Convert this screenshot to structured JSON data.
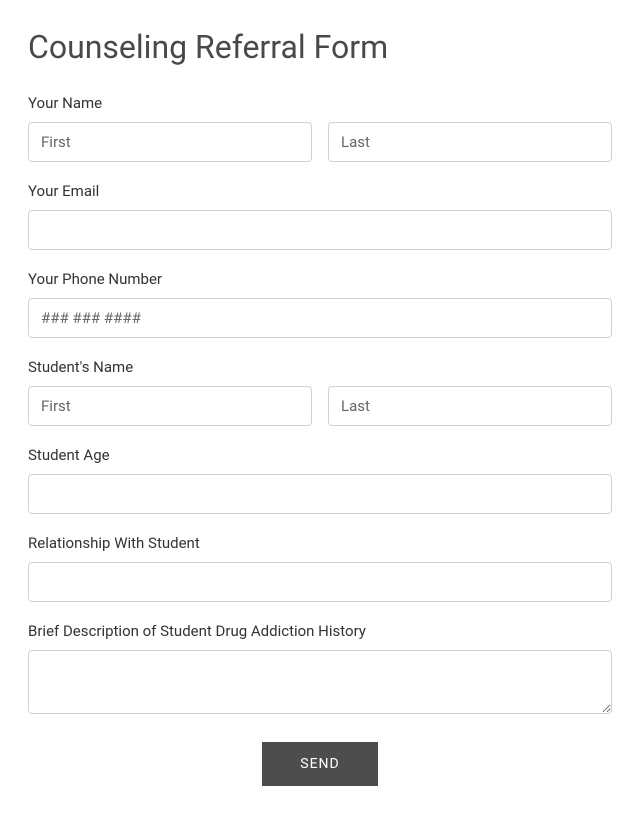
{
  "form": {
    "title": "Counseling Referral Form",
    "fields": {
      "your_name": {
        "label": "Your Name",
        "first_placeholder": "First",
        "last_placeholder": "Last"
      },
      "your_email": {
        "label": "Your Email"
      },
      "your_phone": {
        "label": "Your Phone Number",
        "placeholder": "### ### ####"
      },
      "student_name": {
        "label": "Student's Name",
        "first_placeholder": "First",
        "last_placeholder": "Last"
      },
      "student_age": {
        "label": "Student Age"
      },
      "relationship": {
        "label": "Relationship With Student"
      },
      "description": {
        "label": "Brief Description of Student Drug Addiction History"
      }
    },
    "submit_label": "SEND"
  }
}
